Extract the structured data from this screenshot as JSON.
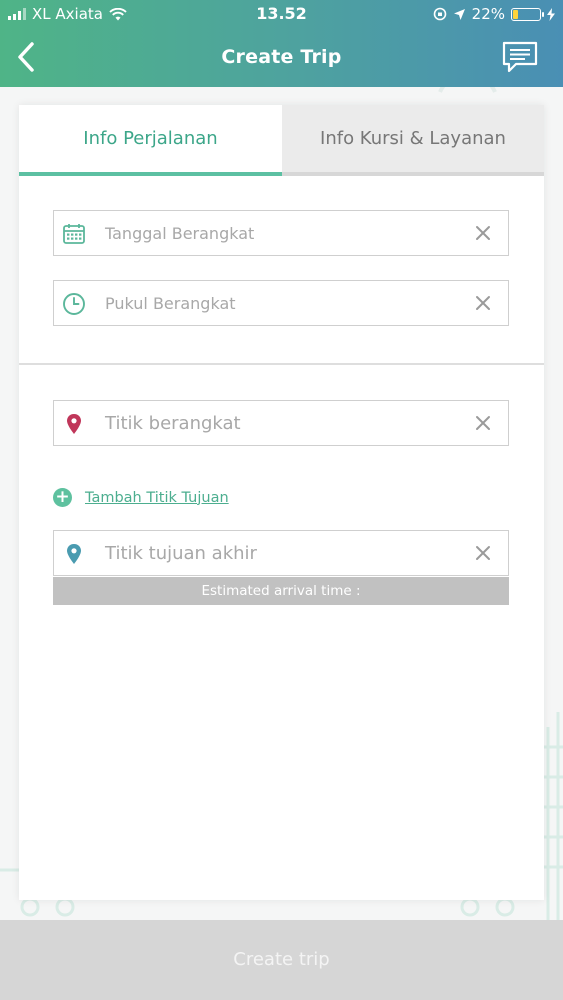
{
  "status_bar": {
    "carrier": "XL Axiata",
    "time": "13.52",
    "battery_percent": "22%",
    "battery_level": 0.22
  },
  "header": {
    "title": "Create Trip"
  },
  "tabs": [
    {
      "label": "Info Perjalanan",
      "active": true
    },
    {
      "label": "Info Kursi & Layanan",
      "active": false
    }
  ],
  "form": {
    "departure_date": {
      "placeholder": "Tanggal Berangkat",
      "icon": "calendar-icon"
    },
    "departure_time": {
      "placeholder": "Pukul Berangkat",
      "icon": "clock-icon"
    },
    "departure_point": {
      "placeholder": "Titik berangkat",
      "icon": "location-pin-icon"
    },
    "add_destination_label": "Tambah Titik Tujuan",
    "final_destination": {
      "placeholder": "Titik tujuan akhir",
      "icon": "location-pin-icon"
    },
    "eta_label": "Estimated arrival time :"
  },
  "footer": {
    "create_button": "Create trip"
  },
  "colors": {
    "accent": "#4cae8f",
    "header_start": "#4fb487",
    "header_end": "#4a8fb4",
    "pin_red": "#c0365a",
    "pin_teal": "#4a9bb0"
  }
}
